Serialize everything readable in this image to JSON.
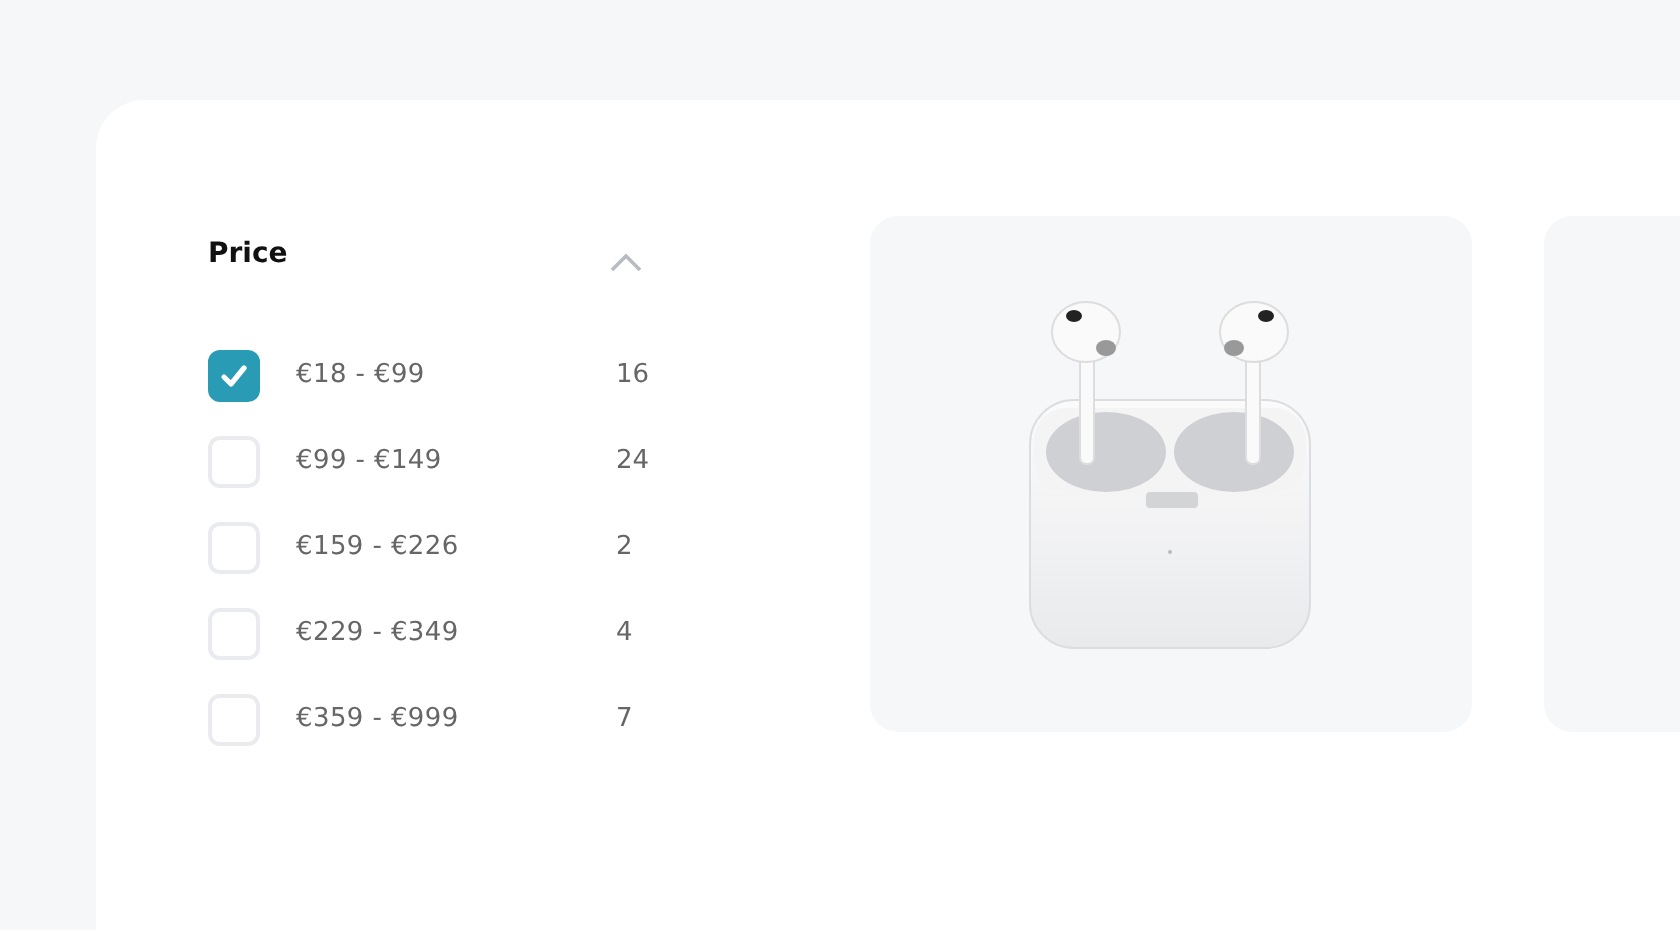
{
  "filter": {
    "title": "Price",
    "expanded": true,
    "options": [
      {
        "label": "€18 - €99",
        "count": "16",
        "checked": true
      },
      {
        "label": "€99 - €149",
        "count": "24",
        "checked": false
      },
      {
        "label": "€159 - €226",
        "count": "2",
        "checked": false
      },
      {
        "label": "€229 - €349",
        "count": "4",
        "checked": false
      },
      {
        "label": "€359 - €999",
        "count": "7",
        "checked": false
      }
    ]
  }
}
